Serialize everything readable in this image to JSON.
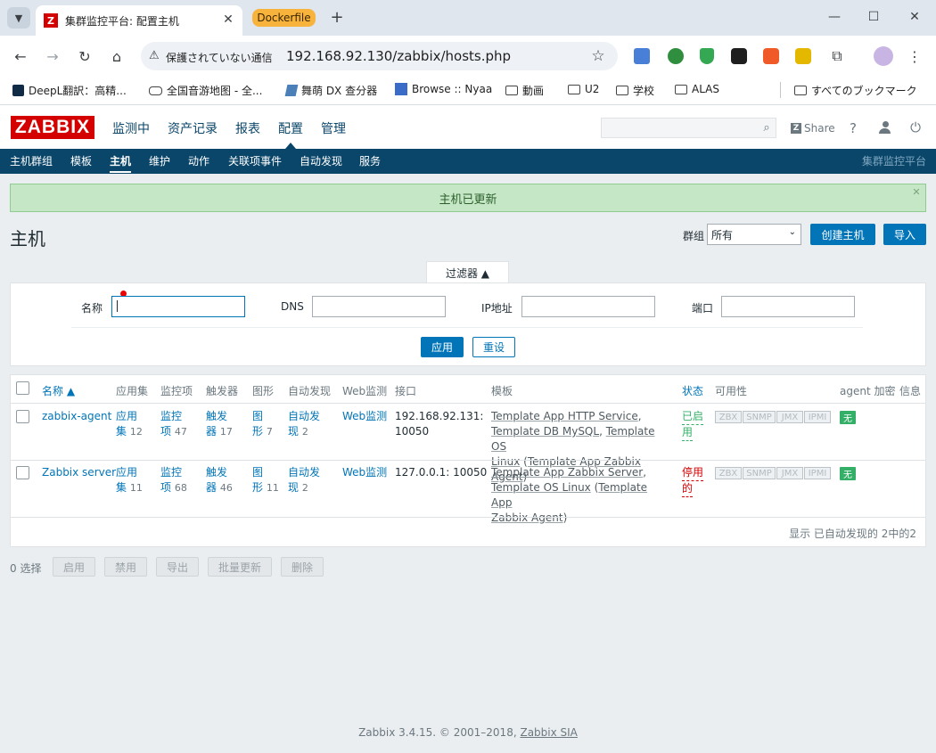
{
  "browser": {
    "tab_title": "集群监控平台: 配置主机",
    "tab_group": "Dockerfile",
    "security_label": "保護されていない通信",
    "url": "192.168.92.130/zabbix/hosts.php",
    "bookmarks": [
      "DeepL翻訳：高精...",
      "全国音游地图 - 全...",
      "舞萌 DX 查分器",
      "Browse :: Nyaa",
      "動画",
      "U2",
      "学校",
      "ALAS"
    ],
    "all_bookmarks": "すべてのブックマーク"
  },
  "header": {
    "logo": "ZABBIX",
    "menu": [
      "监测中",
      "资产记录",
      "报表",
      "配置",
      "管理"
    ],
    "share_label": "Share",
    "help": "?"
  },
  "subnav": {
    "items": [
      "主机群组",
      "模板",
      "主机",
      "维护",
      "动作",
      "关联项事件",
      "自动发现",
      "服务"
    ],
    "active": "主机",
    "server_name": "集群监控平台"
  },
  "message": "主机已更新",
  "page": {
    "title": "主机",
    "group_label": "群组",
    "group_value": "所有",
    "create_host": "创建主机",
    "import": "导入"
  },
  "filter": {
    "tab_label": "过滤器 ▲",
    "name_label": "名称",
    "name_value": "",
    "dns_label": "DNS",
    "ip_label": "IP地址",
    "port_label": "端口",
    "apply": "应用",
    "reset": "重设"
  },
  "table": {
    "headers": [
      "名称 ▲",
      "应用集",
      "监控项",
      "触发器",
      "图形",
      "自动发现",
      "Web监测",
      "接口",
      "模板",
      "状态",
      "可用性",
      "agent 加密",
      "信息"
    ],
    "rows": [
      {
        "name": "zabbix-agent",
        "apps_a": "应用",
        "apps_b": "集",
        "apps_count": "12",
        "items_a": "监控",
        "items_b": "项",
        "items_count": "47",
        "triggers_a": "触发",
        "triggers_b": "器",
        "triggers_count": "17",
        "graphs_a": "图",
        "graphs_b": "形",
        "graphs_count": "7",
        "disc_a": "自动发",
        "disc_b": "现",
        "disc_count": "2",
        "web": "Web监测",
        "iface_a": "192.168.92.131:",
        "iface_b": "10050",
        "tpl_1": "Template App HTTP Service",
        "tpl_2": "Template DB MySQL",
        "tpl_3a": "Template OS",
        "tpl_3b": "Linux",
        "tpl_4": "Template App Zabbix Agent",
        "status_a": "已启",
        "status_b": "用",
        "encryption": "无"
      },
      {
        "name": "Zabbix server",
        "apps_a": "应用",
        "apps_b": "集",
        "apps_count": "11",
        "items_a": "监控",
        "items_b": "项",
        "items_count": "68",
        "triggers_a": "触发",
        "triggers_b": "器",
        "triggers_count": "46",
        "graphs_a": "图",
        "graphs_b": "形",
        "graphs_count": "11",
        "disc_a": "自动发",
        "disc_b": "现",
        "disc_count": "2",
        "web": "Web监测",
        "iface_a": "127.0.0.1: 10050",
        "iface_b": "",
        "tpl_1": "Template App Zabbix Server",
        "tpl_2": "Template OS Linux",
        "tpl_3a": "Template App",
        "tpl_3b": "Zabbix Agent",
        "tpl_4": "",
        "status_a": "停用",
        "status_b": "的",
        "encryption": "无"
      }
    ],
    "availability": [
      "ZBX",
      "SNMP",
      "JMX",
      "IPMI"
    ],
    "footer": "显示 已自动发现的 2中的2"
  },
  "actions": {
    "selected": "0 选择",
    "buttons": [
      "启用",
      "禁用",
      "导出",
      "批量更新",
      "删除"
    ]
  },
  "footer": {
    "text": "Zabbix 3.4.15. © 2001–2018,",
    "company": "Zabbix SIA"
  },
  "colors": {
    "brand": "#d40000",
    "nav": "#0a466a",
    "primary": "#0275b8",
    "success_bg": "#c5e7c6",
    "enabled": "#34af67",
    "disabled": "#d40000"
  }
}
